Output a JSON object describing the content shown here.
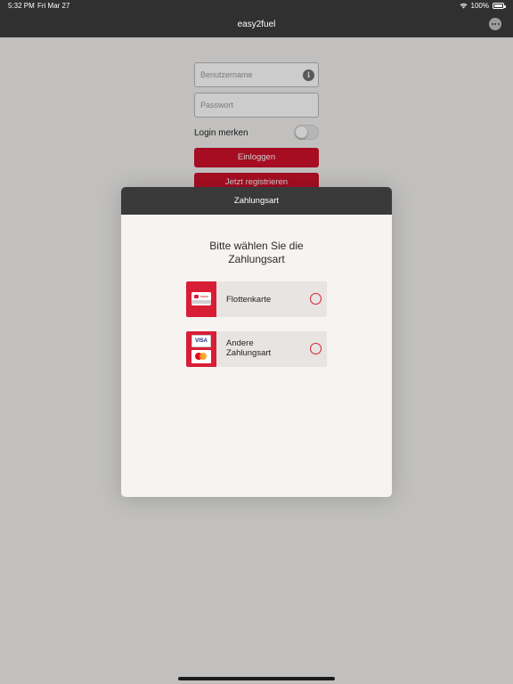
{
  "status_bar": {
    "time": "5:32 PM",
    "date": "Fri Mar 27",
    "battery": "100%"
  },
  "nav": {
    "title": "easy2fuel",
    "more_icon": "more-dots-icon"
  },
  "login": {
    "username_placeholder": "Benutzername",
    "password_placeholder": "Passwort",
    "remember_label": "Login merken",
    "remember_on": false,
    "login_button": "Einloggen",
    "register_button": "Jetzt registrieren"
  },
  "modal": {
    "title": "Zahlungsart",
    "prompt": "Bitte wählen Sie die Zahlungsart",
    "options": [
      {
        "label": "Flottenkarte",
        "icon": "fleet-card-icon",
        "selected": false
      },
      {
        "label": "Andere Zahlungsart",
        "icon": "visa-mastercard-icon",
        "selected": false
      }
    ],
    "visa_text": "VISA"
  },
  "colors": {
    "accent_red": "#d0112b",
    "header_dark": "#303030",
    "modal_bg": "#f7f3f0"
  }
}
